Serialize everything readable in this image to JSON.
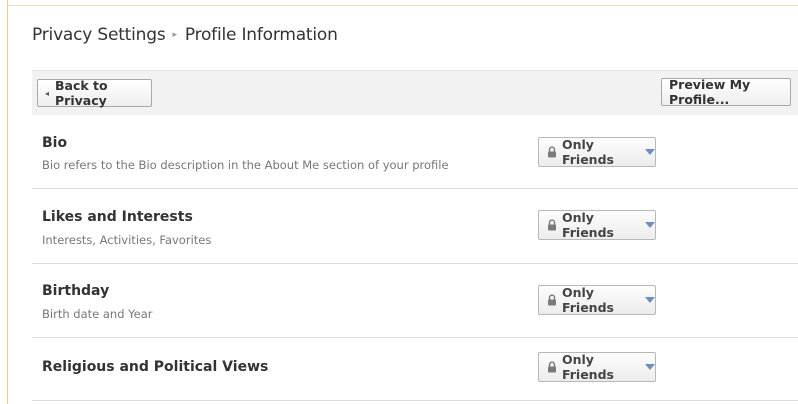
{
  "breadcrumb": {
    "parent": "Privacy Settings",
    "separator": "▸",
    "current": "Profile Information"
  },
  "toolbar": {
    "back_label": "Back to Privacy",
    "back_icon": "◂",
    "preview_label": "Preview My Profile..."
  },
  "settings": [
    {
      "title": "Bio",
      "description": "Bio refers to the Bio description in the About Me section of your profile",
      "value": "Only Friends"
    },
    {
      "title": "Likes and Interests",
      "description": "Interests, Activities, Favorites",
      "value": "Only Friends"
    },
    {
      "title": "Birthday",
      "description": "Birth date and Year",
      "value": "Only Friends"
    },
    {
      "title": "Religious and Political Views",
      "description": "",
      "value": "Only Friends"
    }
  ],
  "icons": {
    "dropdown_lock": "lock-icon",
    "dropdown_caret": "caret-down-icon"
  },
  "colors": {
    "frame": "#f3c98a",
    "caret": "#6d8fbf",
    "toolbar_bg": "#f2f2f2"
  }
}
